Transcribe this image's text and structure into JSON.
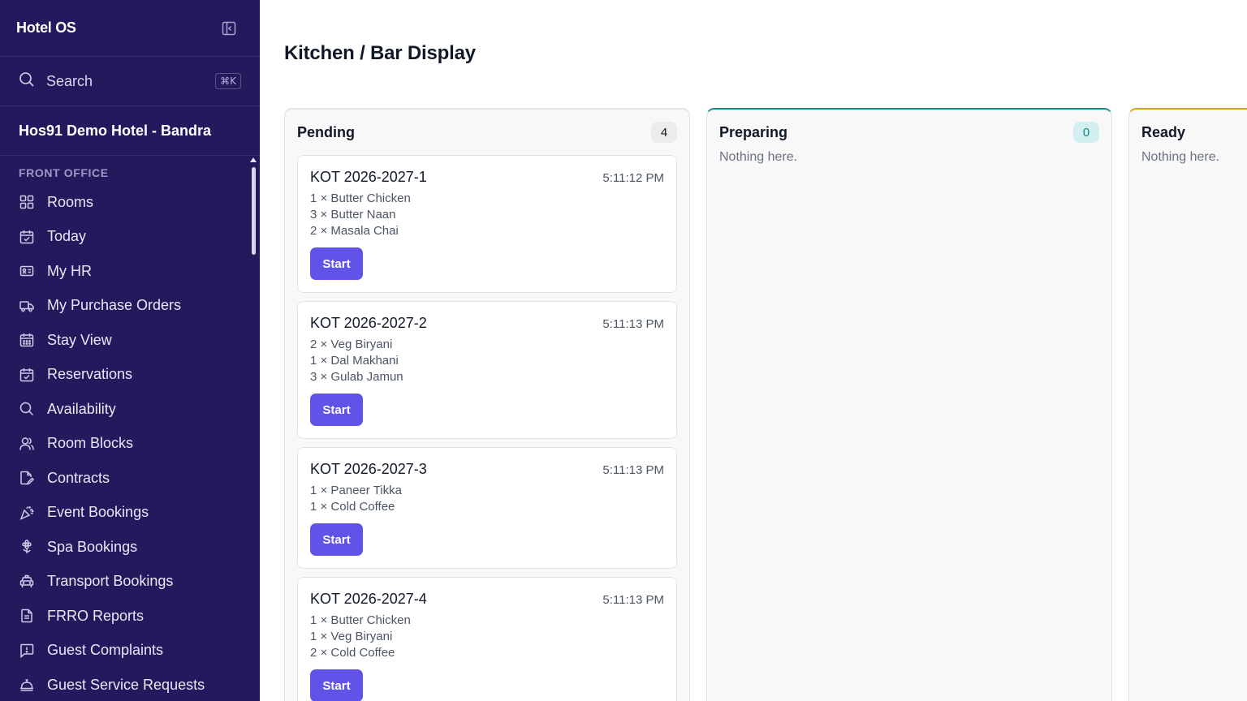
{
  "app": {
    "title": "Hotel OS"
  },
  "search": {
    "label": "Search",
    "shortcut": "⌘K"
  },
  "hotel": {
    "name": "Hos91 Demo Hotel - Bandra"
  },
  "sidebar": {
    "section_title": "FRONT OFFICE",
    "items": [
      {
        "label": "Rooms",
        "icon": "grid-icon"
      },
      {
        "label": "Today",
        "icon": "calendar-check-icon"
      },
      {
        "label": "My HR",
        "icon": "id-card-icon"
      },
      {
        "label": "My Purchase Orders",
        "icon": "truck-icon"
      },
      {
        "label": "Stay View",
        "icon": "calendar-grid-icon"
      },
      {
        "label": "Reservations",
        "icon": "calendar-check-icon"
      },
      {
        "label": "Availability",
        "icon": "search-icon"
      },
      {
        "label": "Room Blocks",
        "icon": "users-icon"
      },
      {
        "label": "Contracts",
        "icon": "file-edit-icon"
      },
      {
        "label": "Event Bookings",
        "icon": "party-popper-icon"
      },
      {
        "label": "Spa Bookings",
        "icon": "flower-icon"
      },
      {
        "label": "Transport Bookings",
        "icon": "taxi-icon"
      },
      {
        "label": "FRRO Reports",
        "icon": "document-icon"
      },
      {
        "label": "Guest Complaints",
        "icon": "message-alert-icon"
      },
      {
        "label": "Guest Service Requests",
        "icon": "concierge-bell-icon"
      }
    ]
  },
  "page": {
    "title": "Kitchen / Bar Display"
  },
  "columns": {
    "pending": {
      "title": "Pending",
      "count": "4",
      "start_label": "Start",
      "tickets": [
        {
          "id": "KOT 2026-2027-1",
          "time": "5:11:12 PM",
          "items": [
            "1 × Butter Chicken",
            "3 × Butter Naan",
            "2 × Masala Chai"
          ]
        },
        {
          "id": "KOT 2026-2027-2",
          "time": "5:11:13 PM",
          "items": [
            "2 × Veg Biryani",
            "1 × Dal Makhani",
            "3 × Gulab Jamun"
          ]
        },
        {
          "id": "KOT 2026-2027-3",
          "time": "5:11:13 PM",
          "items": [
            "1 × Paneer Tikka",
            "1 × Cold Coffee"
          ]
        },
        {
          "id": "KOT 2026-2027-4",
          "time": "5:11:13 PM",
          "items": [
            "1 × Butter Chicken",
            "1 × Veg Biryani",
            "2 × Cold Coffee"
          ]
        }
      ]
    },
    "preparing": {
      "title": "Preparing",
      "count": "0",
      "empty_text": "Nothing here."
    },
    "ready": {
      "title": "Ready",
      "empty_text": "Nothing here."
    }
  },
  "colors": {
    "sidebar_bg": "#231a5e",
    "accent": "#6152e8",
    "preparing_accent": "#0f8a8a",
    "ready_accent": "#d4a017"
  }
}
